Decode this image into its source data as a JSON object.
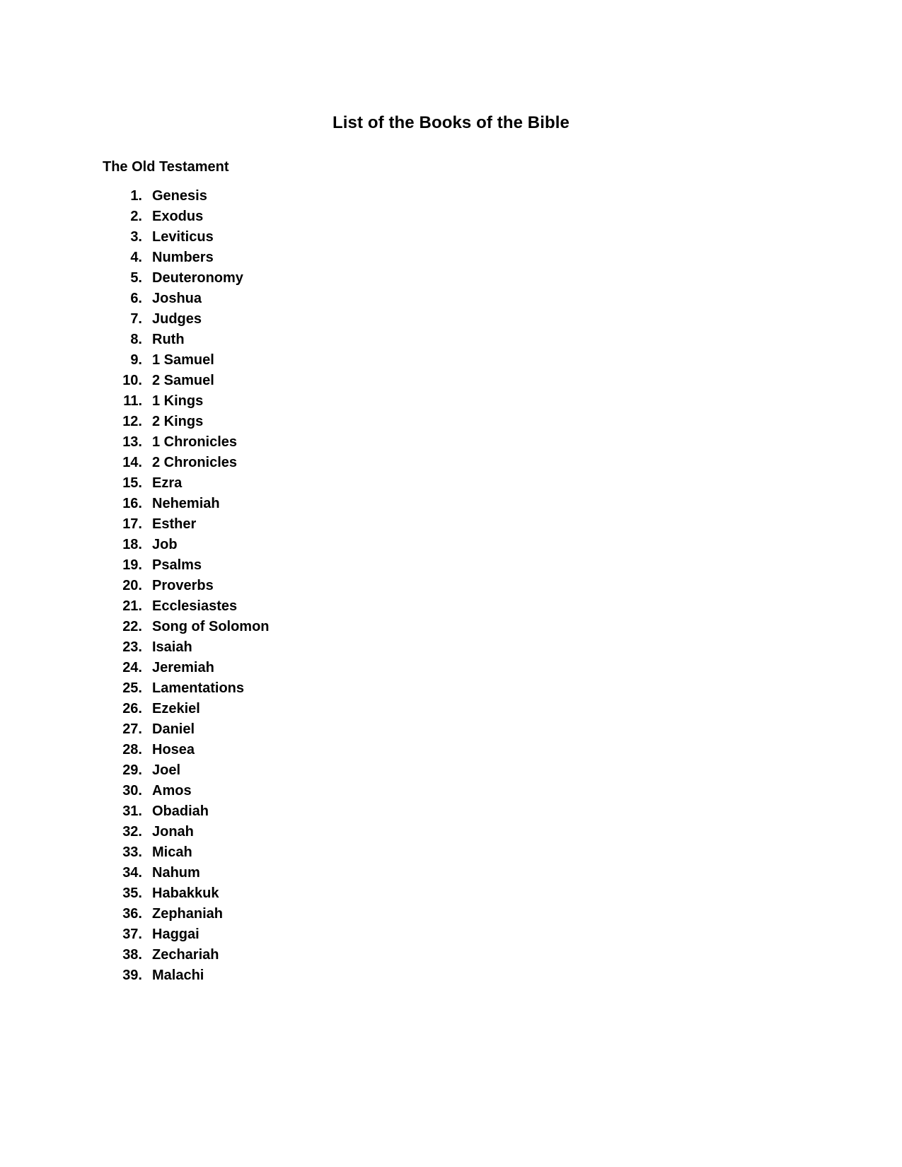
{
  "document": {
    "title": "List of the Books of the Bible",
    "background_color": "#ffffff",
    "text_color": "#000000"
  },
  "sections": [
    {
      "heading": "The Old Testament",
      "items": [
        {
          "number": "1.",
          "name": "Genesis"
        },
        {
          "number": "2.",
          "name": "Exodus"
        },
        {
          "number": "3.",
          "name": "Leviticus"
        },
        {
          "number": "4.",
          "name": "Numbers"
        },
        {
          "number": "5.",
          "name": "Deuteronomy"
        },
        {
          "number": "6.",
          "name": "Joshua"
        },
        {
          "number": "7.",
          "name": "Judges"
        },
        {
          "number": "8.",
          "name": "Ruth"
        },
        {
          "number": "9.",
          "name": "1 Samuel"
        },
        {
          "number": "10.",
          "name": "2 Samuel"
        },
        {
          "number": "11.",
          "name": "1 Kings"
        },
        {
          "number": "12.",
          "name": "2 Kings"
        },
        {
          "number": "13.",
          "name": "1 Chronicles"
        },
        {
          "number": "14.",
          "name": "2 Chronicles"
        },
        {
          "number": "15.",
          "name": "Ezra"
        },
        {
          "number": "16.",
          "name": "Nehemiah"
        },
        {
          "number": "17.",
          "name": "Esther"
        },
        {
          "number": "18.",
          "name": "Job"
        },
        {
          "number": "19.",
          "name": "Psalms"
        },
        {
          "number": "20.",
          "name": "Proverbs"
        },
        {
          "number": "21.",
          "name": "Ecclesiastes"
        },
        {
          "number": "22.",
          "name": "Song of Solomon"
        },
        {
          "number": "23.",
          "name": "Isaiah"
        },
        {
          "number": "24.",
          "name": "Jeremiah"
        },
        {
          "number": "25.",
          "name": "Lamentations"
        },
        {
          "number": "26.",
          "name": "Ezekiel"
        },
        {
          "number": "27.",
          "name": "Daniel"
        },
        {
          "number": "28.",
          "name": "Hosea"
        },
        {
          "number": "29.",
          "name": "Joel"
        },
        {
          "number": "30.",
          "name": "Amos"
        },
        {
          "number": "31.",
          "name": "Obadiah"
        },
        {
          "number": "32.",
          "name": "Jonah"
        },
        {
          "number": "33.",
          "name": "Micah"
        },
        {
          "number": "34.",
          "name": "Nahum"
        },
        {
          "number": "35.",
          "name": "Habakkuk"
        },
        {
          "number": "36.",
          "name": "Zephaniah"
        },
        {
          "number": "37.",
          "name": "Haggai"
        },
        {
          "number": "38.",
          "name": "Zechariah"
        },
        {
          "number": "39.",
          "name": "Malachi"
        }
      ]
    }
  ]
}
